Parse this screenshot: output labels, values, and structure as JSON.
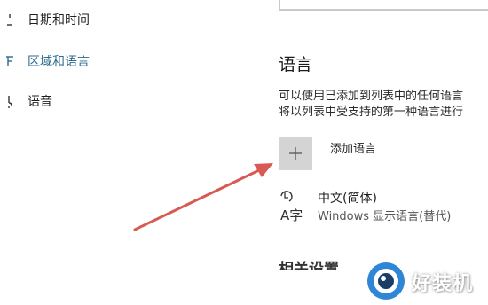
{
  "nav": {
    "items": [
      {
        "label": "日期和时间",
        "icon": "clock-icon",
        "active": false
      },
      {
        "label": "区域和语言",
        "icon": "region-icon",
        "active": true
      },
      {
        "label": "语音",
        "icon": "microphone-icon",
        "active": false
      }
    ]
  },
  "content": {
    "heading": "语言",
    "description": [
      "可以使用已添加到列表中的任何语言",
      "将以列表中受支持的第一种语言进行"
    ],
    "add_language": {
      "label": "添加语言",
      "icon": "plus-icon"
    },
    "languages": [
      {
        "name": "中文(简体)",
        "sub": "Windows 显示语言(替代)",
        "icon": "language-icon"
      }
    ],
    "related_heading": "相关设置"
  },
  "overlay": {
    "arrow_color": "#d95a52",
    "watermark_text": "好装机",
    "watermark_logo": "watermark-logo-icon"
  },
  "colors": {
    "accent": "#2c6a8e",
    "plus_box": "#d4d4d4"
  }
}
